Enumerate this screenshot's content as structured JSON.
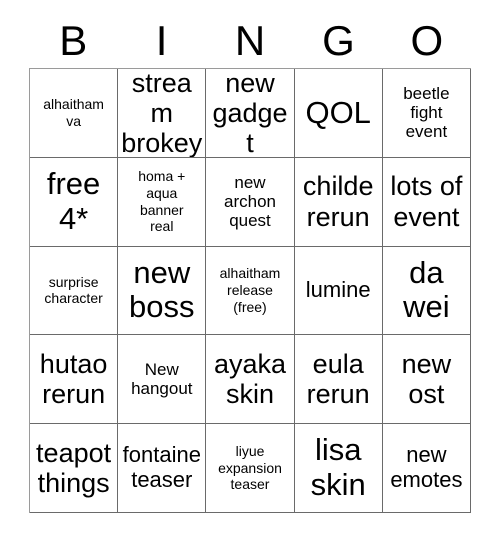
{
  "header": {
    "letters": [
      "B",
      "I",
      "N",
      "G",
      "O"
    ]
  },
  "grid": {
    "columns": 5,
    "rows": 5,
    "cells": [
      {
        "text": "alhaitham\nva",
        "size": "xs"
      },
      {
        "text": "stream\nbrokey",
        "size": "lg"
      },
      {
        "text": "new\ngadget",
        "size": "lg"
      },
      {
        "text": "QOL",
        "size": "xl"
      },
      {
        "text": "beetle\nfight\nevent",
        "size": "sm"
      },
      {
        "text": "free\n4*",
        "size": "xl"
      },
      {
        "text": "homa +\naqua\nbanner\nreal",
        "size": "xs"
      },
      {
        "text": "new\narchon\nquest",
        "size": "sm"
      },
      {
        "text": "childe\nrerun",
        "size": "lg"
      },
      {
        "text": "lots of\nevent",
        "size": "lg"
      },
      {
        "text": "surprise\ncharacter",
        "size": "xs"
      },
      {
        "text": "new\nboss",
        "size": "xl"
      },
      {
        "text": "alhaitham\nrelease\n(free)",
        "size": "xs"
      },
      {
        "text": "lumine",
        "size": "md"
      },
      {
        "text": "da\nwei",
        "size": "xl"
      },
      {
        "text": "hutao\nrerun",
        "size": "lg"
      },
      {
        "text": "New\nhangout",
        "size": "sm"
      },
      {
        "text": "ayaka\nskin",
        "size": "lg"
      },
      {
        "text": "eula\nrerun",
        "size": "lg"
      },
      {
        "text": "new\nost",
        "size": "lg"
      },
      {
        "text": "teapot\nthings",
        "size": "lg"
      },
      {
        "text": "fontaine\nteaser",
        "size": "md"
      },
      {
        "text": "liyue\nexpansion\nteaser",
        "size": "xs"
      },
      {
        "text": "lisa\nskin",
        "size": "xl"
      },
      {
        "text": "new\nemotes",
        "size": "md"
      }
    ]
  },
  "colors": {
    "background": "#ffffff",
    "text": "#000000",
    "grid_line": "#6a6a6a"
  }
}
